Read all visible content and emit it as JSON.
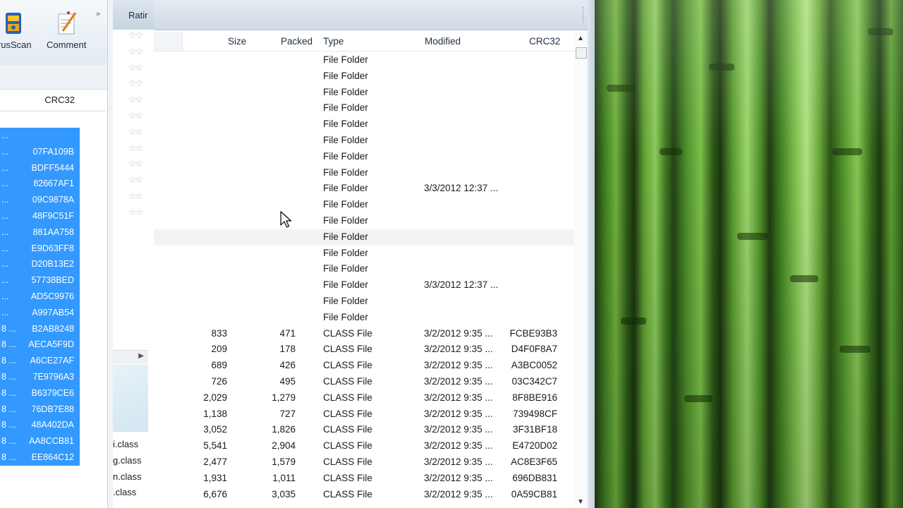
{
  "back_window": {
    "toolbar": [
      {
        "label": "irusScan",
        "icon": "virusscan-icon"
      },
      {
        "label": "Comment",
        "icon": "comment-icon"
      }
    ],
    "column": "CRC32",
    "rows": [
      {
        "prefix": "...",
        "crc": ""
      },
      {
        "prefix": "...",
        "crc": "07FA109B"
      },
      {
        "prefix": "...",
        "crc": "BDFF5444"
      },
      {
        "prefix": "...",
        "crc": "82667AF1"
      },
      {
        "prefix": "...",
        "crc": "09C9878A"
      },
      {
        "prefix": "...",
        "crc": "48F9C51F"
      },
      {
        "prefix": "...",
        "crc": "881AA758"
      },
      {
        "prefix": "...",
        "crc": "E9D63FF8"
      },
      {
        "prefix": "...",
        "crc": "D20B13E2"
      },
      {
        "prefix": "...",
        "crc": "57738BED"
      },
      {
        "prefix": "...",
        "crc": "AD5C9976"
      },
      {
        "prefix": "...",
        "crc": "A997AB54"
      },
      {
        "prefix": "8 ...",
        "crc": "B2AB8248"
      },
      {
        "prefix": "8 ...",
        "crc": "AECA5F9D"
      },
      {
        "prefix": "8 ...",
        "crc": "A6CE27AF"
      },
      {
        "prefix": "8 ...",
        "crc": "7E9796A3"
      },
      {
        "prefix": "8 ...",
        "crc": "B6379CE6"
      },
      {
        "prefix": "8 ...",
        "crc": "76DB7E88"
      },
      {
        "prefix": "8 ...",
        "crc": "48A402DA"
      },
      {
        "prefix": "8 ...",
        "crc": "AA8CCB81"
      },
      {
        "prefix": "8 ...",
        "crc": "EE864C12"
      }
    ]
  },
  "mid_window": {
    "header": "Ratir",
    "star_glyph": "☆☆",
    "fragment": "t",
    "files": [
      "i.class",
      "g.class",
      "n.class",
      ".class"
    ]
  },
  "main": {
    "columns": {
      "size": "Size",
      "packed": "Packed",
      "type": "Type",
      "modified": "Modified",
      "crc": "CRC32"
    },
    "rows": [
      {
        "size": "",
        "packed": "",
        "type": "File Folder",
        "modified": "",
        "crc": ""
      },
      {
        "size": "",
        "packed": "",
        "type": "File Folder",
        "modified": "",
        "crc": ""
      },
      {
        "size": "",
        "packed": "",
        "type": "File Folder",
        "modified": "",
        "crc": ""
      },
      {
        "size": "",
        "packed": "",
        "type": "File Folder",
        "modified": "",
        "crc": ""
      },
      {
        "size": "",
        "packed": "",
        "type": "File Folder",
        "modified": "",
        "crc": ""
      },
      {
        "size": "",
        "packed": "",
        "type": "File Folder",
        "modified": "",
        "crc": ""
      },
      {
        "size": "",
        "packed": "",
        "type": "File Folder",
        "modified": "",
        "crc": ""
      },
      {
        "size": "",
        "packed": "",
        "type": "File Folder",
        "modified": "",
        "crc": ""
      },
      {
        "size": "",
        "packed": "",
        "type": "File Folder",
        "modified": "3/3/2012 12:37 ...",
        "crc": ""
      },
      {
        "size": "",
        "packed": "",
        "type": "File Folder",
        "modified": "",
        "crc": ""
      },
      {
        "size": "",
        "packed": "",
        "type": "File Folder",
        "modified": "",
        "crc": ""
      },
      {
        "size": "",
        "packed": "",
        "type": "File Folder",
        "modified": "",
        "crc": "",
        "hover": true
      },
      {
        "size": "",
        "packed": "",
        "type": "File Folder",
        "modified": "",
        "crc": ""
      },
      {
        "size": "",
        "packed": "",
        "type": "File Folder",
        "modified": "",
        "crc": ""
      },
      {
        "size": "",
        "packed": "",
        "type": "File Folder",
        "modified": "3/3/2012 12:37 ...",
        "crc": ""
      },
      {
        "size": "",
        "packed": "",
        "type": "File Folder",
        "modified": "",
        "crc": ""
      },
      {
        "size": "",
        "packed": "",
        "type": "File Folder",
        "modified": "",
        "crc": ""
      },
      {
        "size": "833",
        "packed": "471",
        "type": "CLASS File",
        "modified": "3/2/2012 9:35 ...",
        "crc": "FCBE93B3"
      },
      {
        "size": "209",
        "packed": "178",
        "type": "CLASS File",
        "modified": "3/2/2012 9:35 ...",
        "crc": "D4F0F8A7"
      },
      {
        "size": "689",
        "packed": "426",
        "type": "CLASS File",
        "modified": "3/2/2012 9:35 ...",
        "crc": "A3BC0052"
      },
      {
        "size": "726",
        "packed": "495",
        "type": "CLASS File",
        "modified": "3/2/2012 9:35 ...",
        "crc": "03C342C7"
      },
      {
        "size": "2,029",
        "packed": "1,279",
        "type": "CLASS File",
        "modified": "3/2/2012 9:35 ...",
        "crc": "8F8BE916"
      },
      {
        "size": "1,138",
        "packed": "727",
        "type": "CLASS File",
        "modified": "3/2/2012 9:35 ...",
        "crc": "739498CF"
      },
      {
        "size": "3,052",
        "packed": "1,826",
        "type": "CLASS File",
        "modified": "3/2/2012 9:35 ...",
        "crc": "3F31BF18"
      },
      {
        "size": "5,541",
        "packed": "2,904",
        "type": "CLASS File",
        "modified": "3/2/2012 9:35 ...",
        "crc": "E4720D02"
      },
      {
        "size": "2,477",
        "packed": "1,579",
        "type": "CLASS File",
        "modified": "3/2/2012 9:35 ...",
        "crc": "AC8E3F65"
      },
      {
        "size": "1,931",
        "packed": "1,011",
        "type": "CLASS File",
        "modified": "3/2/2012 9:35 ...",
        "crc": "696DB831"
      },
      {
        "size": "6,676",
        "packed": "3,035",
        "type": "CLASS File",
        "modified": "3/2/2012 9:35 ...",
        "crc": "0A59CB81"
      }
    ]
  },
  "colors": {
    "selection": "#3399ff",
    "wallpaper": "#4f9229"
  },
  "icons": {
    "scroll_up": "scroll-up-icon",
    "scroll_down": "scroll-down-icon",
    "cursor": "mouse-pointer-icon"
  }
}
